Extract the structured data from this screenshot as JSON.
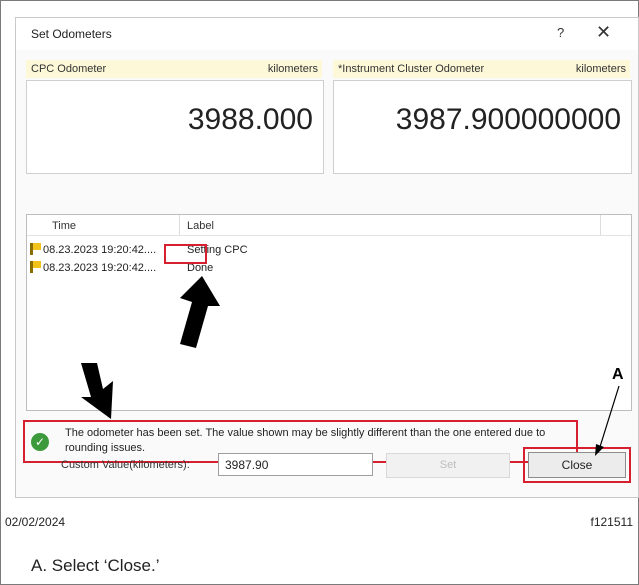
{
  "dialog": {
    "title": "Set Odometers",
    "help_glyph": "?",
    "close_glyph": "✕"
  },
  "cpc": {
    "label": "CPC Odometer",
    "unit": "kilometers",
    "value": "3988.000"
  },
  "cluster": {
    "label": "*Instrument Cluster Odometer",
    "unit": "kilometers",
    "value": "3987.900000000"
  },
  "log": {
    "col_time": "Time",
    "col_label": "Label",
    "rows": [
      {
        "time": "08.23.2023 19:20:42....",
        "label": "Setting CPC"
      },
      {
        "time": "08.23.2023 19:20:42....",
        "label": "Done"
      }
    ]
  },
  "status": {
    "icon": "check-circle-icon",
    "text": "The odometer has been set. The value shown may be slightly different than the one entered due to rounding issues."
  },
  "footer": {
    "custom_label": "Custom Value(kilometers):",
    "custom_value": "3987.90",
    "set_label": "Set",
    "close_label": "Close"
  },
  "annotation": {
    "callout": "A",
    "date": "02/02/2024",
    "figure": "f121511",
    "caption": "A. Select ‘Close.’"
  },
  "colors": {
    "highlight": "#d6202f",
    "header_bg": "#fdf9d8",
    "success": "#3c9a3c"
  }
}
